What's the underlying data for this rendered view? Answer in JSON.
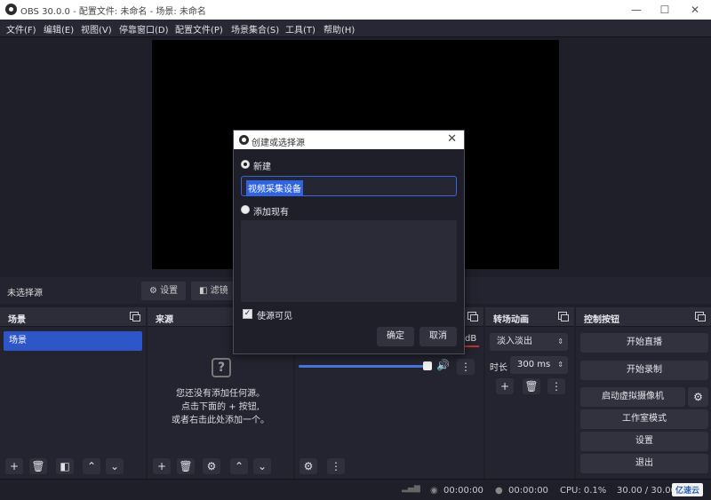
{
  "window": {
    "title": "OBS 30.0.0 - 配置文件: 未命名 - 场景: 未命名",
    "minimize": "—",
    "maximize": "☐",
    "close": "✕"
  },
  "menu": [
    "文件(F)",
    "编辑(E)",
    "视图(V)",
    "停靠窗口(D)",
    "配置文件(P)",
    "场景集合(S)",
    "工具(T)",
    "帮助(H)"
  ],
  "context_bar": {
    "no_source": "未选择源",
    "settings": "设置",
    "filters": "滤镜"
  },
  "scenes_dock": {
    "title": "场景",
    "items": [
      "场景"
    ]
  },
  "sources_dock": {
    "title": "来源",
    "empty_line1": "您还没有添加任何源。",
    "empty_line2": "点击下面的 + 按钮,",
    "empty_line3": "或者右击此处添加一个。"
  },
  "mixer_dock": {
    "db_suffix": "dB"
  },
  "transitions_dock": {
    "title": "转场动画",
    "transition": "淡入淡出",
    "duration_label": "时长",
    "duration": "300 ms"
  },
  "controls_dock": {
    "title": "控制按钮",
    "start_streaming": "开始直播",
    "start_recording": "开始录制",
    "start_virtual_camera": "启动虚拟摄像机",
    "studio_mode": "工作室模式",
    "settings": "设置",
    "exit": "退出"
  },
  "status_bar": {
    "stream_time": "00:00:00",
    "record_time": "00:00:00",
    "cpu": "CPU: 0.1%",
    "fps": "30.00 / 30.00 FPS"
  },
  "watermark": "亿速云",
  "dialog": {
    "title": "创建或选择源",
    "create_new": "新建",
    "name_value": "视频采集设备",
    "add_existing": "添加现有",
    "visible_label": "使源可见",
    "ok": "确定",
    "cancel": "取消"
  },
  "colors": {
    "accent": "#2d56c8",
    "panel": "#23242f",
    "background": "#1e1f29"
  }
}
